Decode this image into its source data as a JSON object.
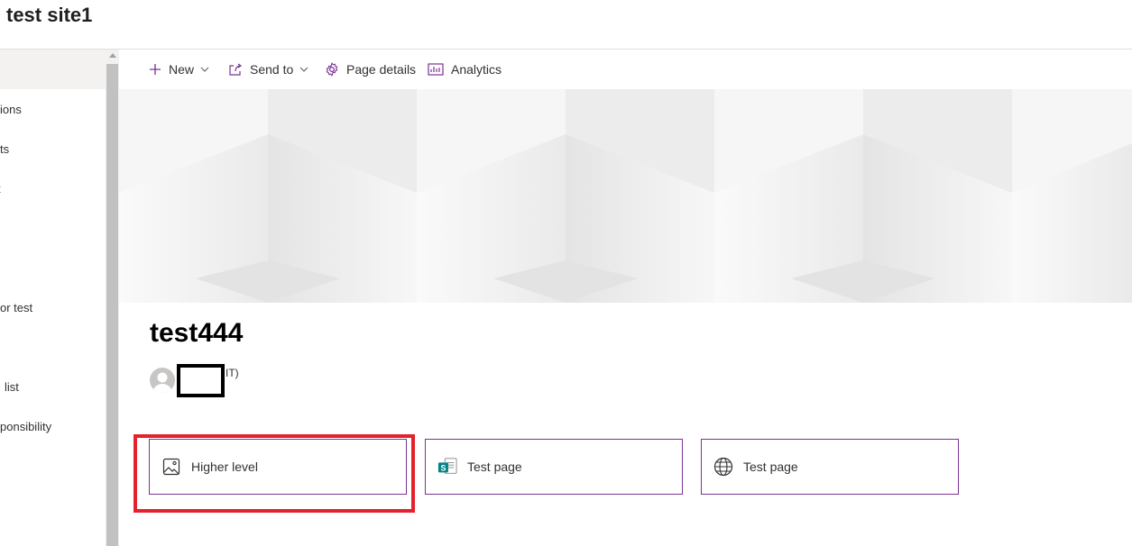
{
  "site": {
    "title": "test site1"
  },
  "nav": {
    "items": [
      "ions",
      "ts",
      "t",
      "or test",
      "list",
      "ponsibility"
    ]
  },
  "commandbar": {
    "new_label": "New",
    "send_to_label": "Send to",
    "page_details_label": "Page details",
    "analytics_label": "Analytics"
  },
  "page": {
    "title": "test444",
    "author_suffix": "IT)"
  },
  "quicklinks": [
    {
      "label": "Higher level",
      "icon": "image-icon"
    },
    {
      "label": "Test page",
      "icon": "sharepoint-icon"
    },
    {
      "label": "Test page",
      "icon": "globe-icon"
    }
  ],
  "colors": {
    "accent": "#7b3294",
    "highlight": "#e3222b",
    "sharepoint": "#038387"
  }
}
